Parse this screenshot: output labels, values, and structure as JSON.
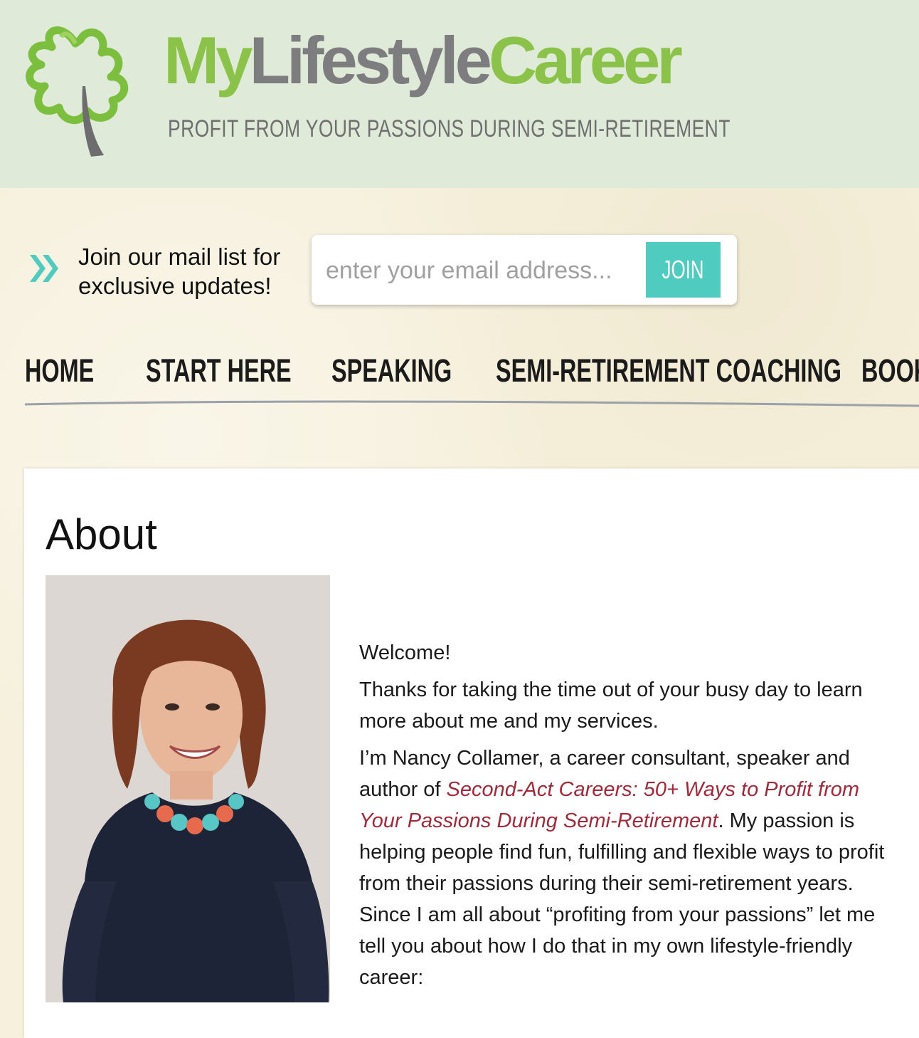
{
  "header": {
    "brand_my": "My",
    "brand_lifestyle": "Lifestyle",
    "brand_career": "Career",
    "tagline": "PROFIT FROM YOUR PASSIONS DURING SEMI-RETIREMENT"
  },
  "signup": {
    "text": "Join our mail list for exclusive updates!",
    "placeholder": "enter your email address...",
    "button": "JOIN"
  },
  "nav": [
    "HOME",
    "START HERE",
    "SPEAKING",
    "SEMI-RETIREMENT COACHING",
    "BOOK"
  ],
  "page": {
    "title": "About",
    "p1": "Welcome!",
    "p2": "Thanks for taking the time out of your busy day to learn more about me and my services.",
    "p3_a": "I’m Nancy Collamer, a career consultant, speaker and author of ",
    "p3_book": "Second-Act Careers: 50+ Ways to Profit from Your Passions During Semi-Retirement",
    "p3_b": ".  My passion is helping people  find fun, fulfilling and flexible ways to profit from their passions during their semi-retirement years. Since I am all about  “profiting from your passions” let me tell you about how I do that in my own lifestyle-friendly career:"
  },
  "colors": {
    "brand_green": "#8bc34a",
    "brand_gray": "#7d7d80",
    "join_teal": "#4fcbc0",
    "book_link": "#a12a3a"
  }
}
